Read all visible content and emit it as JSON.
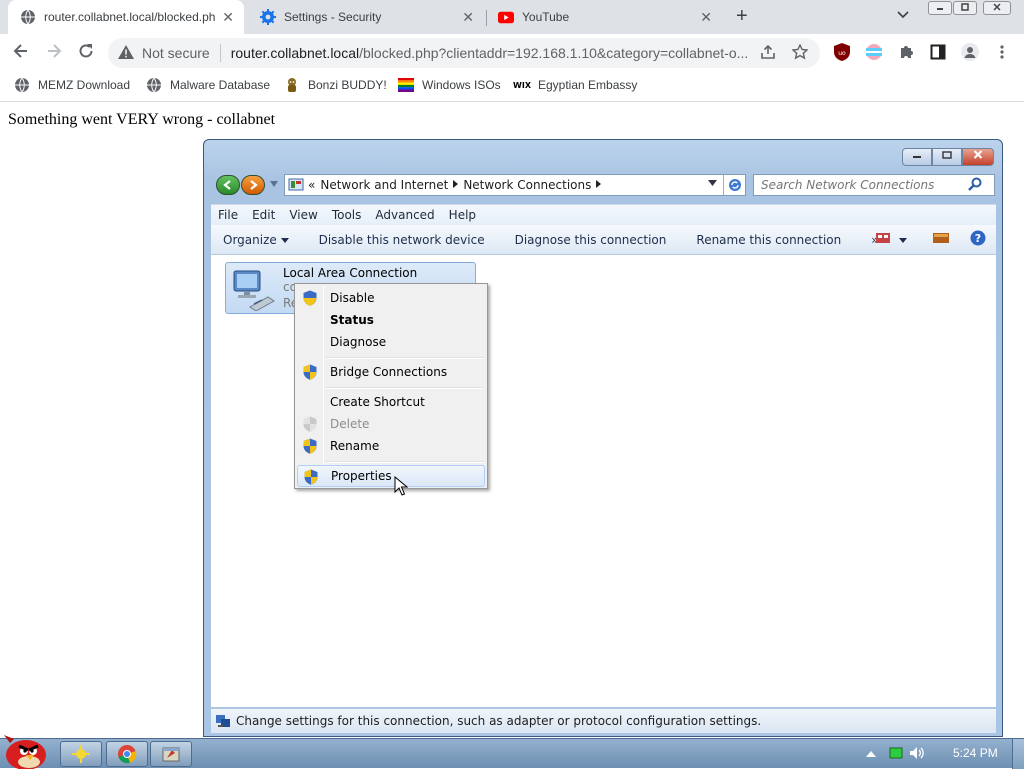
{
  "browser": {
    "tabs": [
      {
        "title": "router.collabnet.local/blocked.ph",
        "icon": "globe-icon",
        "active": true
      },
      {
        "title": "Settings - Security",
        "icon": "gear-icon",
        "active": false
      },
      {
        "title": "YouTube",
        "icon": "youtube-icon",
        "active": false
      }
    ],
    "close_glyph": "✕",
    "new_tab_glyph": "+",
    "omnibox": {
      "security_label": "Not secure",
      "url_host": "router.collabnet.local",
      "url_rest": "/blocked.php?clientaddr=192.168.1.10&category=collabnet-o..."
    },
    "bookmarks": [
      {
        "label": "MEMZ Download",
        "icon": "globe-icon"
      },
      {
        "label": "Malware Database",
        "icon": "globe-icon"
      },
      {
        "label": "Bonzi BUDDY!",
        "icon": "bonzi-icon"
      },
      {
        "label": "Windows ISOs",
        "icon": "rainbow-flag-icon"
      },
      {
        "label": "Egyptian Embassy",
        "icon": "wix-icon"
      }
    ],
    "wix_text": "WIX"
  },
  "page": {
    "heading": "Something went VERY wrong - collabnet"
  },
  "explorer": {
    "breadcrumbs": [
      "Network and Internet",
      "Network Connections"
    ],
    "crumb_prefix": "«",
    "search_placeholder": "Search Network Connections",
    "menu": [
      "File",
      "Edit",
      "View",
      "Tools",
      "Advanced",
      "Help"
    ],
    "commands": [
      "Organize",
      "Disable this network device",
      "Diagnose this connection",
      "Rename this connection"
    ],
    "more_glyph": "»",
    "connection": {
      "name": "Local Area Connection",
      "line2": "co",
      "line3": "Re"
    },
    "status_text": "Change settings for this connection, such as adapter or protocol configuration settings.",
    "context_menu": [
      {
        "label": "Disable",
        "shield": true,
        "bold": false,
        "disabled": false
      },
      {
        "label": "Status",
        "shield": false,
        "bold": true,
        "disabled": false
      },
      {
        "label": "Diagnose",
        "shield": false,
        "bold": false,
        "disabled": false
      },
      {
        "label": "Bridge Connections",
        "shield": true,
        "bold": false,
        "disabled": false
      },
      {
        "label": "Create Shortcut",
        "shield": false,
        "bold": false,
        "disabled": false
      },
      {
        "label": "Delete",
        "shield": true,
        "bold": false,
        "disabled": true
      },
      {
        "label": "Rename",
        "shield": true,
        "bold": false,
        "disabled": false
      },
      {
        "label": "Properties",
        "shield": true,
        "bold": false,
        "disabled": false,
        "hover": true
      }
    ]
  },
  "taskbar": {
    "clock": "5:24 PM"
  },
  "colors": {
    "chrome_tabbar": "#dee1e6",
    "win7_frame": "#aac5e3",
    "selection": "#c3daf4",
    "taskbar": "#6e8fb2"
  }
}
